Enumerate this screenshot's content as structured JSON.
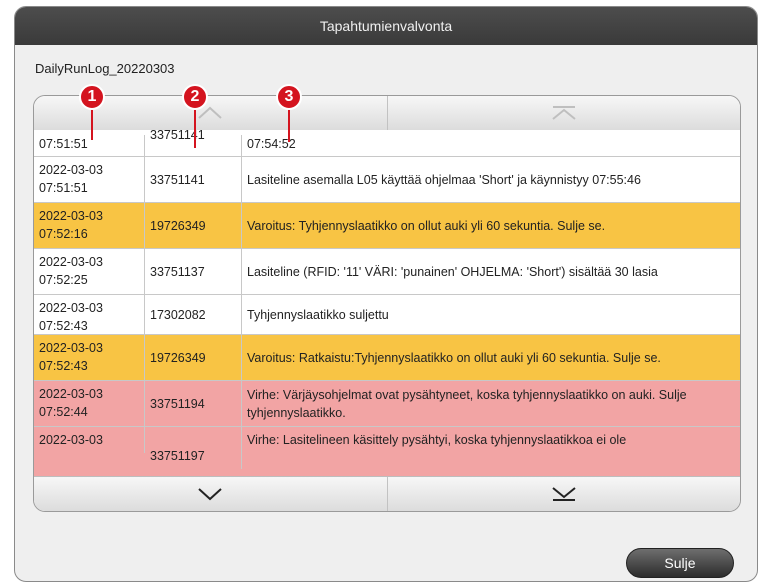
{
  "dialog": {
    "title": "Tapahtumienvalvonta",
    "log_name": "DailyRunLog_20220303"
  },
  "nav": {
    "top_left_icon": "chevron-up-icon",
    "top_right_icon": "scroll-to-top-icon",
    "bottom_left_icon": "chevron-down-icon",
    "bottom_right_icon": "scroll-to-bottom-icon"
  },
  "rows": [
    {
      "time": "07:51:51",
      "code": "33751141",
      "message": "07:54:52",
      "type": "white"
    },
    {
      "time": "2022-03-03 07:51:51",
      "code": "33751141",
      "message": "Lasiteline asemalla L05 käyttää ohjelmaa 'Short' ja käynnistyy 07:55:46",
      "type": "white"
    },
    {
      "time": "2022-03-03 07:52:16",
      "code": "19726349",
      "message": "Varoitus: Tyhjennyslaatikko on ollut auki yli 60 sekuntia. Sulje se.",
      "type": "warning"
    },
    {
      "time": "2022-03-03 07:52:25",
      "code": "33751137",
      "message": "Lasiteline (RFID: '11' VÄRI: 'punainen' OHJELMA: 'Short') sisältää 30 lasia",
      "type": "white"
    },
    {
      "time": "2022-03-03 07:52:43",
      "code": "17302082",
      "message": "Tyhjennyslaatikko suljettu",
      "type": "white"
    },
    {
      "time": "2022-03-03 07:52:43",
      "code": "19726349",
      "message": "Varoitus: Ratkaistu:Tyhjennyslaatikko on ollut auki yli 60 sekuntia. Sulje se.",
      "type": "warning"
    },
    {
      "time": "2022-03-03 07:52:44",
      "code": "33751194",
      "message": "Virhe: Värjäysohjelmat ovat pysähtyneet, koska tyhjennyslaatikko on auki. Sulje tyhjennyslaatikko.",
      "type": "error"
    },
    {
      "time": "2022-03-03",
      "code": "33751197",
      "message": "Virhe: Lasitelineen käsittely pysähtyi, koska tyhjennyslaatikkoa ei ole",
      "type": "error"
    }
  ],
  "close_button": {
    "label": "Sulje"
  },
  "callouts": [
    "1",
    "2",
    "3"
  ],
  "colors": {
    "warning": "#f8c444",
    "error": "#f2a4a4",
    "callout": "#d4141f"
  }
}
